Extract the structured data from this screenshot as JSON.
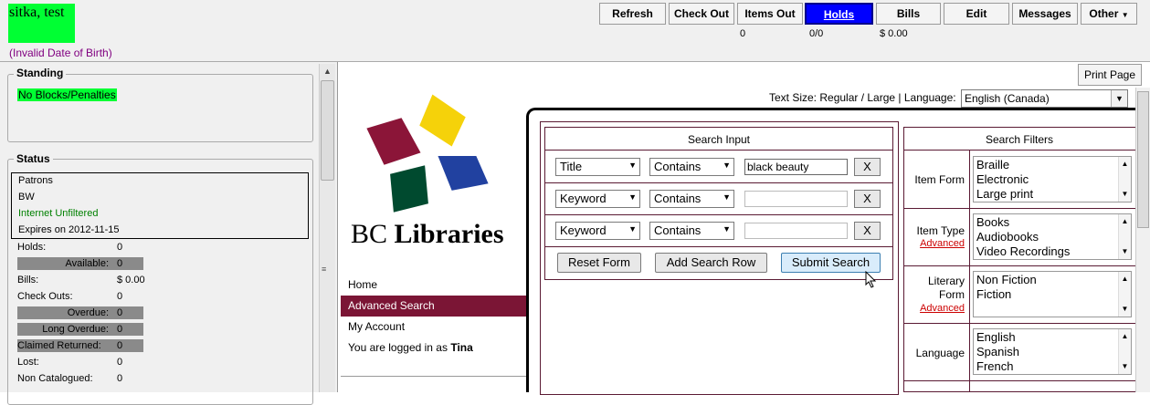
{
  "patron": {
    "name": "sitka, test",
    "dob_warning": "(Invalid Date of Birth)"
  },
  "toolbar": {
    "refresh": "Refresh",
    "checkout": "Check Out",
    "items_out": "Items Out",
    "holds": "Holds",
    "bills": "Bills",
    "edit": "Edit",
    "messages": "Messages",
    "other": "Other",
    "items_out_count": "0",
    "holds_count": "0/0",
    "bills_amount": "$ 0.00"
  },
  "standing": {
    "legend": "Standing",
    "value": "No Blocks/Penalties"
  },
  "status": {
    "legend": "Status",
    "profile": "Patrons",
    "location": "BW",
    "internet": "Internet Unfiltered",
    "expires": "Expires on 2012-11-15",
    "rows": [
      {
        "label": "Holds:",
        "value": "0"
      },
      {
        "label": "Available:",
        "value": "0"
      },
      {
        "label": "Bills:",
        "value": "$ 0.00"
      },
      {
        "label": "Check Outs:",
        "value": "0"
      },
      {
        "label": "Overdue:",
        "value": "0"
      },
      {
        "label": "Long Overdue:",
        "value": "0"
      },
      {
        "label": "Claimed Returned:",
        "value": "0"
      },
      {
        "label": "Lost:",
        "value": "0"
      },
      {
        "label": "Non Catalogued:",
        "value": "0"
      }
    ]
  },
  "opac": {
    "print_page": "Print Page",
    "text_size_label": "Text Size: Regular / Large",
    "language_label": "Language:",
    "language_value": "English (Canada)",
    "brand_bc": "BC",
    "brand_libraries": "Libraries",
    "nav": {
      "home": "Home",
      "advanced": "Advanced Search",
      "account": "My Account",
      "logged_prefix": "You are logged in as",
      "logged_user": "Tina"
    },
    "search_input": {
      "title": "Search Input",
      "rows": [
        {
          "field": "Title",
          "op": "Contains",
          "value": "black beauty"
        },
        {
          "field": "Keyword",
          "op": "Contains",
          "value": ""
        },
        {
          "field": "Keyword",
          "op": "Contains",
          "value": ""
        }
      ],
      "remove": "X",
      "reset": "Reset Form",
      "add_row": "Add Search Row",
      "submit": "Submit Search"
    },
    "filters": {
      "title": "Search Filters",
      "advanced": "Advanced",
      "item_form": {
        "label": "Item Form",
        "options": [
          "Braille",
          "Electronic",
          "Large print"
        ]
      },
      "item_type": {
        "label": "Item Type",
        "options": [
          "Books",
          "Audiobooks",
          "Video Recordings"
        ]
      },
      "literary_form": {
        "label_1": "Literary",
        "label_2": "Form",
        "options": [
          "Non Fiction",
          "Fiction"
        ]
      },
      "language": {
        "label": "Language",
        "options": [
          "English",
          "Spanish",
          "French"
        ]
      }
    }
  },
  "colors": {
    "green": "#00ff33",
    "holds_blue": "#0000ff",
    "nav_maroon": "#7b1535",
    "panel_border": "#5a1a33"
  }
}
